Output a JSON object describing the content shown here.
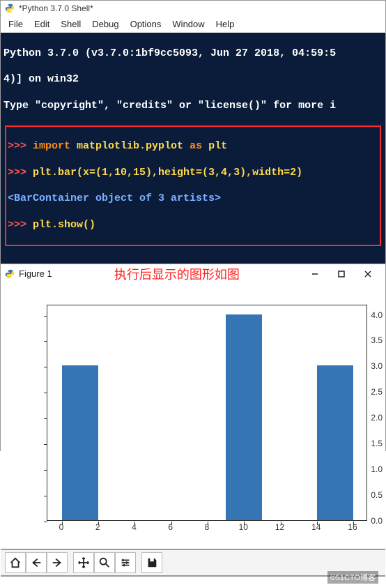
{
  "shell": {
    "title": "*Python 3.7.0 Shell*",
    "menu": [
      "File",
      "Edit",
      "Shell",
      "Debug",
      "Options",
      "Window",
      "Help"
    ],
    "banner_line1": "Python 3.7.0 (v3.7.0:1bf9cc5093, Jun 27 2018, 04:59:5",
    "banner_line2": "4)] on win32",
    "banner_line3": "Type \"copyright\", \"credits\" or \"license()\" for more i",
    "code": {
      "l1_prompt": ">>> ",
      "l1_import": "import",
      "l1_rest1": " matplotlib.pyplot ",
      "l1_as": "as",
      "l1_rest2": " plt",
      "l2_prompt": ">>> ",
      "l2_code": "plt.bar(x=(1,10,15),height=(3,4,3),width=2)",
      "l3_output": "<BarContainer object of 3 artists>",
      "l4_prompt": ">>> ",
      "l4_code": "plt.show()"
    }
  },
  "figure": {
    "title": "Figure 1",
    "caption_cn": "执行后显示的图形如图",
    "toolbar": {
      "home": "home-icon",
      "back": "back-icon",
      "forward": "forward-icon",
      "pan": "pan-icon",
      "zoom": "zoom-icon",
      "configure": "configure-icon",
      "save": "save-icon"
    }
  },
  "chart_data": {
    "type": "bar",
    "x": [
      1,
      10,
      15
    ],
    "height": [
      3,
      4,
      3
    ],
    "width": 2,
    "x_ticks": [
      0,
      2,
      4,
      6,
      8,
      10,
      12,
      14,
      16
    ],
    "y_ticks": [
      0.0,
      0.5,
      1.0,
      1.5,
      2.0,
      2.5,
      3.0,
      3.5,
      4.0
    ],
    "y_tick_labels": [
      "0.0",
      "0.5",
      "1.0",
      "1.5",
      "2.0",
      "2.5",
      "3.0",
      "3.5",
      "4.0"
    ],
    "xlim": [
      -0.8,
      16.8
    ],
    "ylim": [
      0.0,
      4.2
    ],
    "xlabel": "",
    "ylabel": "",
    "title": ""
  },
  "watermark": "©51CTO博客"
}
